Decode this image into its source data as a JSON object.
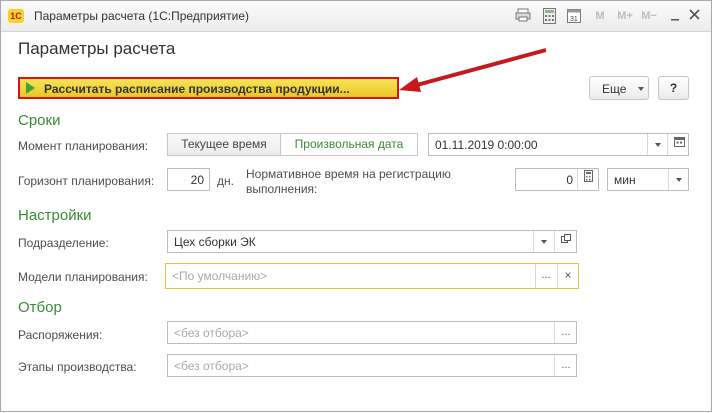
{
  "window": {
    "logo_text": "1С",
    "title": "Параметры расчета  (1С:Предприятие)",
    "toolbar": [
      "print-icon",
      "calculator-icon",
      "calendar-icon",
      "M",
      "M+",
      "M−"
    ]
  },
  "form": {
    "title": "Параметры расчета",
    "run_button": "Рассчитать расписание производства продукции...",
    "more_button": "Еще",
    "help_button": "?"
  },
  "sections": {
    "terms": "Сроки",
    "settings": "Настройки",
    "filter": "Отбор"
  },
  "fields": {
    "planning_moment_label": "Момент планирования:",
    "toggle_current": "Текущее время",
    "toggle_arbitrary": "Произвольная дата",
    "date_value": "01.11.2019  0:00:00",
    "horizon_label": "Горизонт планирования:",
    "horizon_value": "20",
    "horizon_unit": "дн.",
    "norm_time_label_1": "Нормативное время на регистрацию",
    "norm_time_label_2": "выполнения:",
    "norm_time_value": "0",
    "norm_unit": "мин",
    "division_label": "Подразделение:",
    "division_value": "Цех сборки ЭК",
    "models_label": "Модели планирования:",
    "models_placeholder": "<По умолчанию>",
    "orders_label": "Распоряжения:",
    "orders_placeholder": "<без отбора>",
    "stages_label": "Этапы производства:",
    "stages_placeholder": "<без отбора>",
    "ellipsis": "...",
    "clear": "×"
  },
  "colors": {
    "accent_green": "#3a8a38",
    "run_button_yellow": "#f1d63a",
    "highlight_red": "#d8141a"
  }
}
